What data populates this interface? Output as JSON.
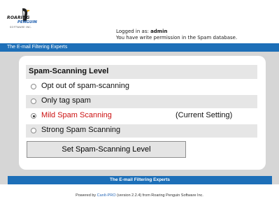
{
  "header": {
    "logo": {
      "line1": "ROARING",
      "line2": "PENGUIN",
      "line3": "SOFTWARE INC."
    },
    "logged_in_prefix": "Logged in as: ",
    "username": "admin",
    "permission_text": "You have write permission in the Spam database.",
    "tagline": "The E-mail Filtering Experts"
  },
  "main": {
    "section_title": "Spam-Scanning Level",
    "options": [
      {
        "label": "Opt out of spam-scanning",
        "checked": false
      },
      {
        "label": "Only tag spam",
        "checked": false
      },
      {
        "label": "Mild Spam Scanning",
        "checked": true
      },
      {
        "label": "Strong Spam Scanning",
        "checked": false
      }
    ],
    "current_setting_label": "(Current Setting)",
    "submit_label": "Set Spam-Scanning Level"
  },
  "footer": {
    "tagline": "The E-mail Filtering Experts",
    "powered_prefix": "Powered by ",
    "product_link": "CanIt-PRO",
    "powered_suffix": " (version 2.2.4) from Roaring Penguin Software Inc."
  },
  "colors": {
    "accent_blue": "#1d6fb8",
    "current_option_red": "#cc1111",
    "page_background": "#d6d6d6"
  }
}
